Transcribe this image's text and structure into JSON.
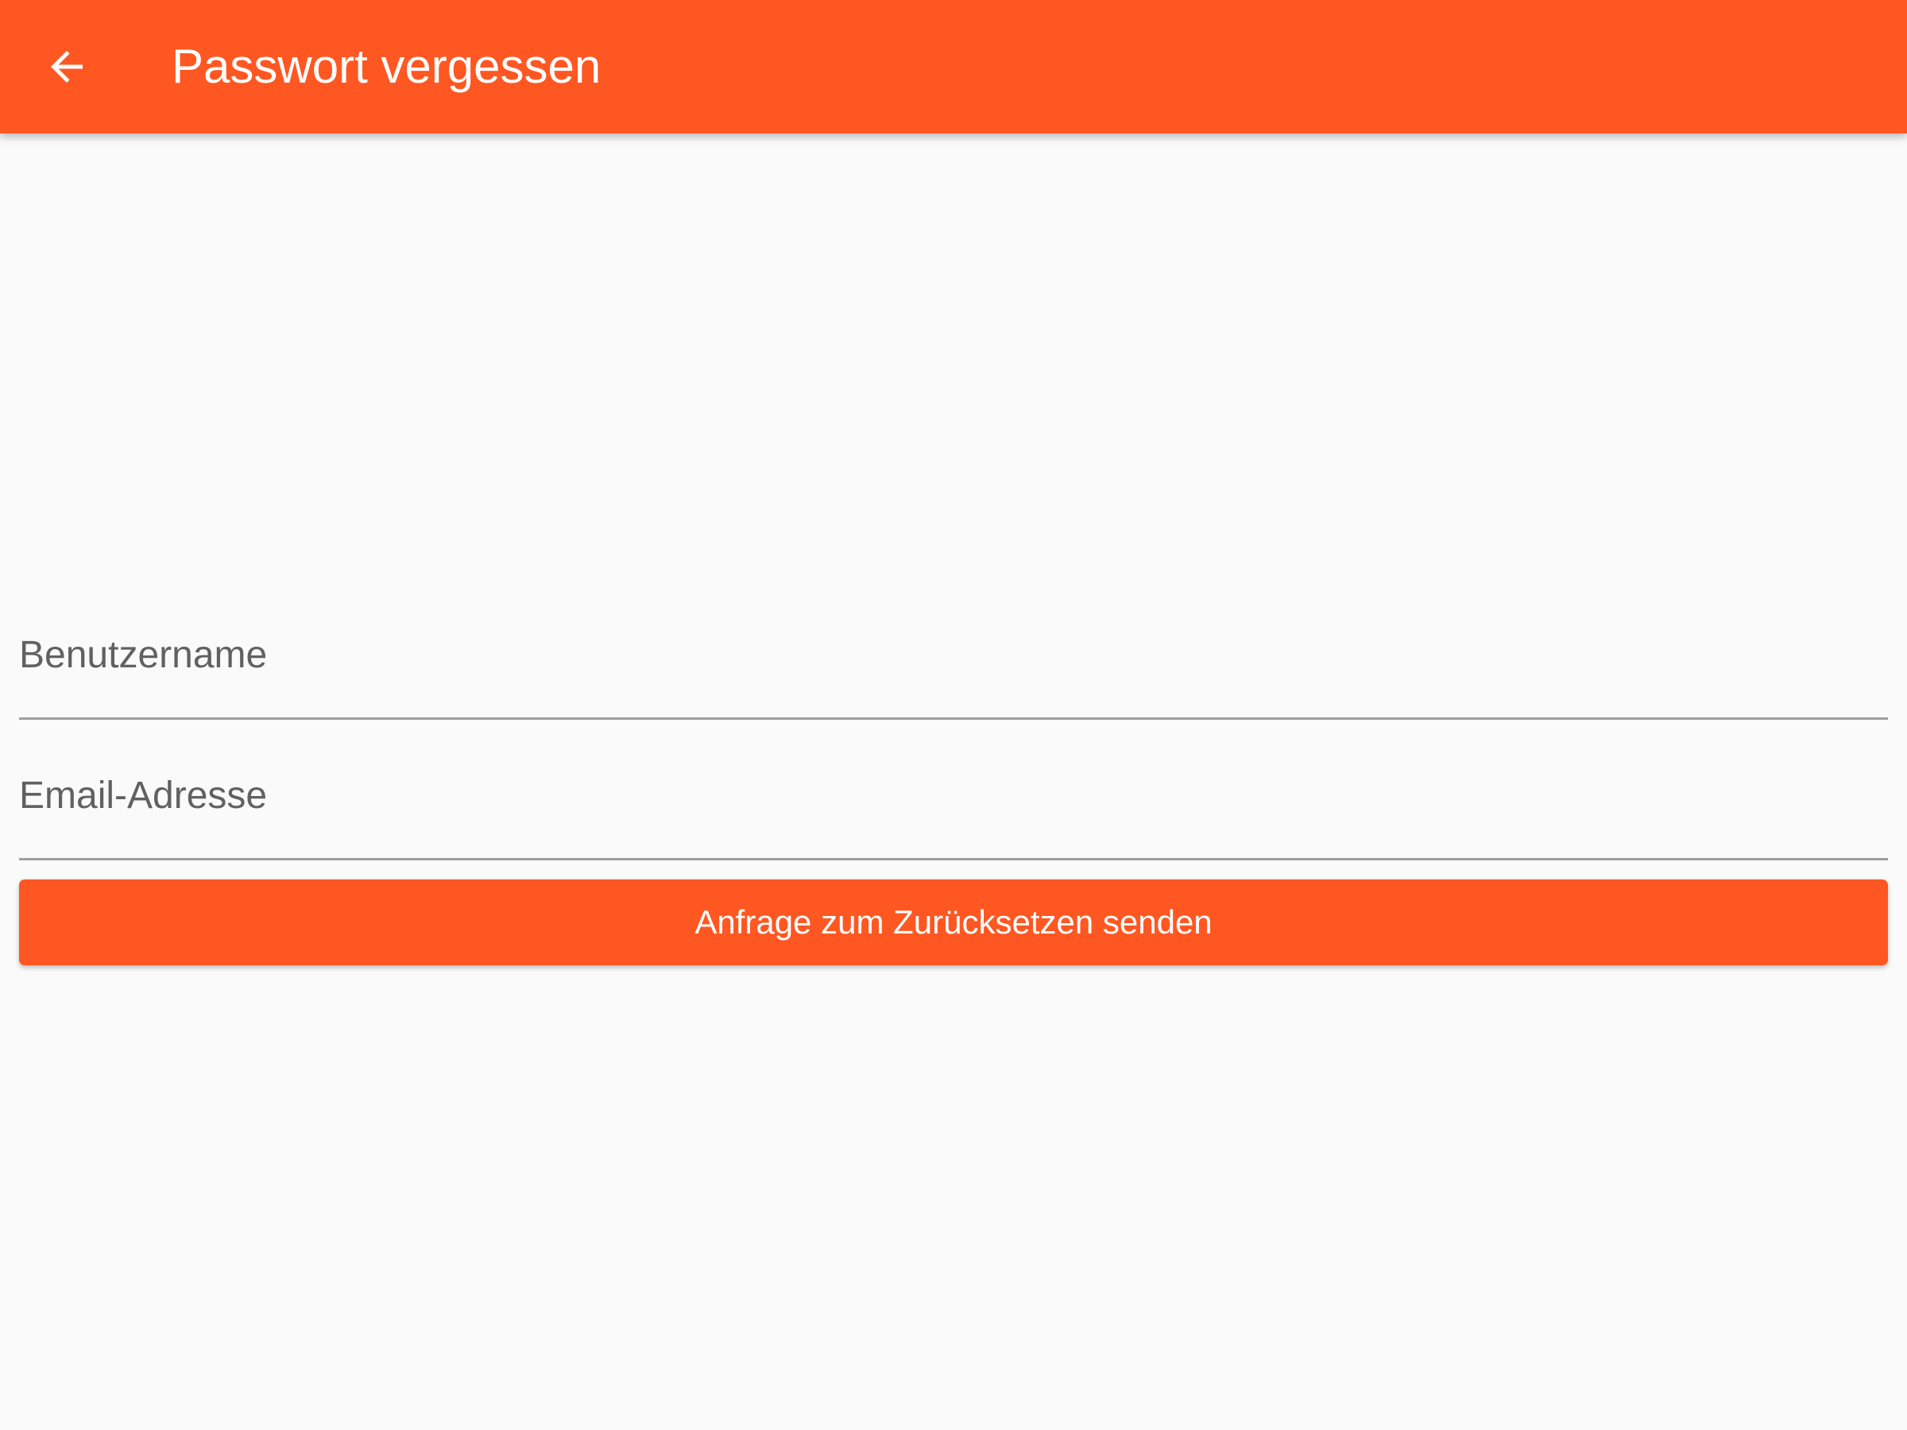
{
  "colors": {
    "accent": "#ff5722",
    "background": "#fafafa",
    "on_accent": "#ffffff",
    "placeholder": "#616161",
    "underline": "#9e9e9e"
  },
  "app_bar": {
    "back_icon": "arrow-left-icon",
    "title": "Passwort vergessen"
  },
  "form": {
    "username": {
      "placeholder": "Benutzername",
      "value": ""
    },
    "email": {
      "placeholder": "Email-Adresse",
      "value": ""
    },
    "submit_label": "Anfrage zum Zurücksetzen senden"
  }
}
